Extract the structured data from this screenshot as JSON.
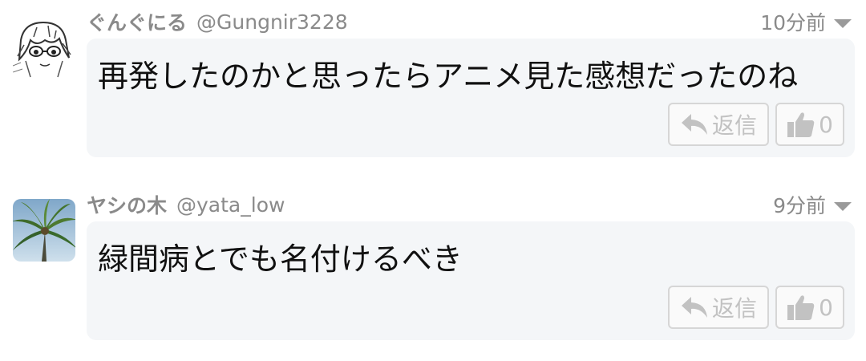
{
  "comments": [
    {
      "user_name": "ぐんぐにる",
      "handle": "@Gungnir3228",
      "time": "10分前",
      "text": "再発したのかと思ったらアニメ見た感想だったのね",
      "reply_label": "返信",
      "like_count": "0",
      "avatar": "anime-character-sketch"
    },
    {
      "user_name": "ヤシの木",
      "handle": "@yata_low",
      "time": "9分前",
      "text": "緑間病とでも名付けるべき",
      "reply_label": "返信",
      "like_count": "0",
      "avatar": "palm-tree-photo"
    }
  ],
  "icons": {
    "menu": "chevron-down-icon",
    "reply": "reply-arrow-icon",
    "like": "thumbs-up-icon"
  },
  "colors": {
    "meta_text": "#8a8a8a",
    "bubble_bg": "#f4f6f8",
    "button_border": "#d6d6d6",
    "button_text": "#c2c2c2"
  }
}
